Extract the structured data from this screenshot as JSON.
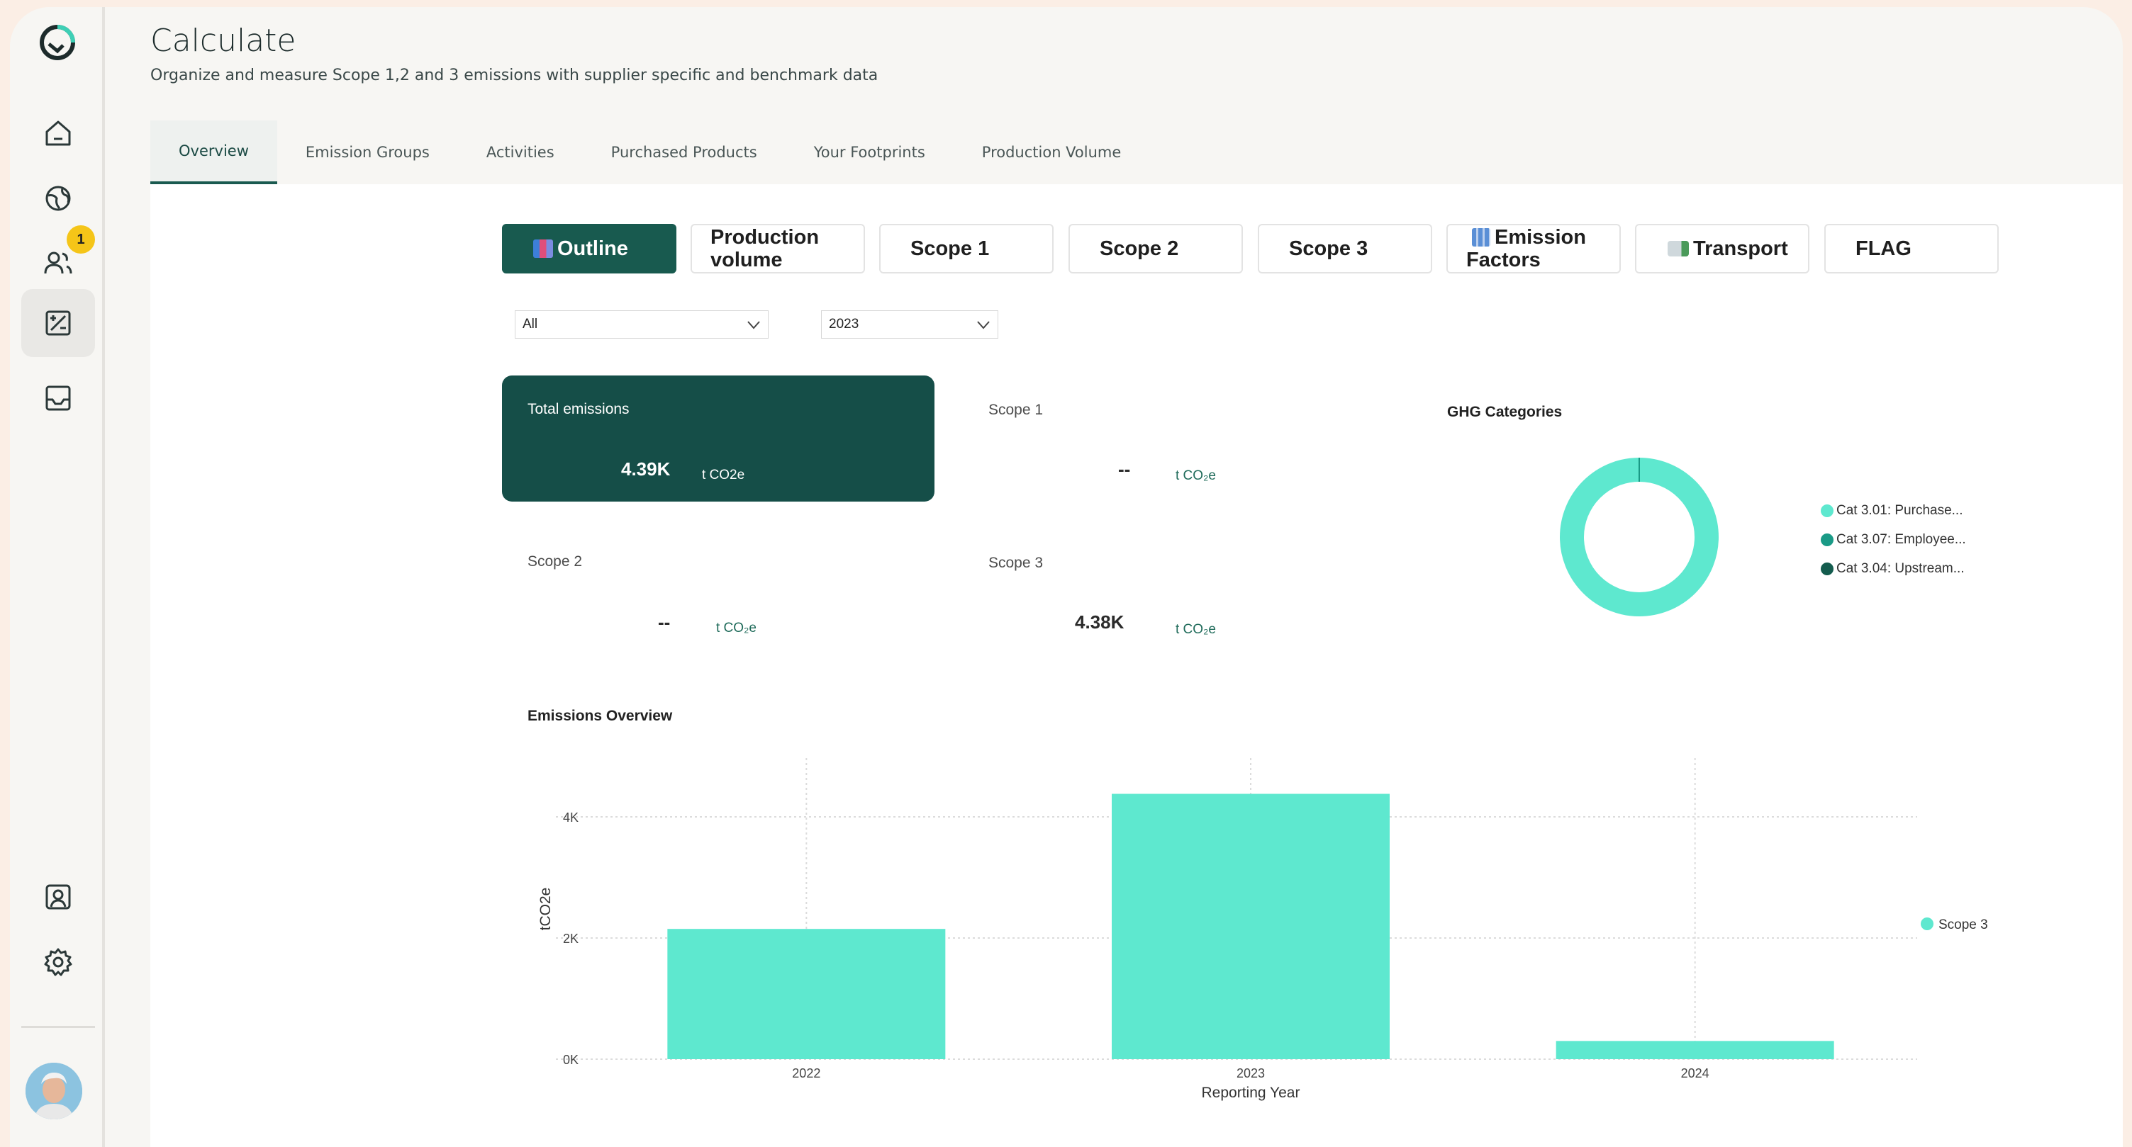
{
  "header": {
    "title": "Calculate",
    "subtitle": "Organize and measure Scope 1,2 and 3 emissions with supplier specific and benchmark data"
  },
  "tabs": [
    {
      "label": "Overview",
      "active": true
    },
    {
      "label": "Emission Groups"
    },
    {
      "label": "Activities"
    },
    {
      "label": "Purchased Products"
    },
    {
      "label": "Your Footprints"
    },
    {
      "label": "Production Volume"
    }
  ],
  "sidebar": {
    "items": [
      {
        "icon": "home-icon"
      },
      {
        "icon": "globe-icon"
      },
      {
        "icon": "users-icon",
        "badge": "1"
      },
      {
        "icon": "calculator-icon",
        "active": true
      },
      {
        "icon": "inbox-icon"
      },
      {
        "icon": "account-icon"
      },
      {
        "icon": "settings-icon"
      }
    ]
  },
  "buttons": {
    "outline": "Outline",
    "production_volume_1": "Production",
    "production_volume_2": "volume",
    "scope1": "Scope 1",
    "scope2": "Scope 2",
    "scope3": "Scope 3",
    "emission_factors_1": "Emission",
    "emission_factors_2": "Factors",
    "transport": "Transport",
    "flag": "FLAG"
  },
  "filters": {
    "category": "All",
    "year": "2023"
  },
  "kpis": {
    "total": {
      "label": "Total emissions",
      "value": "4.39K",
      "unit": "t CO2e"
    },
    "scope1": {
      "label": "Scope 1",
      "value": "--",
      "unit": "t CO₂e"
    },
    "scope2": {
      "label": "Scope 2",
      "value": "--",
      "unit": "t CO₂e"
    },
    "scope3": {
      "label": "Scope 3",
      "value": "4.38K",
      "unit": "t CO₂e"
    }
  },
  "ghg": {
    "title": "GHG Categories",
    "legend": [
      {
        "label": "Cat 3.01: Purchase...",
        "color": "#5ee8cf"
      },
      {
        "label": "Cat 3.07: Employee...",
        "color": "#1a9a86"
      },
      {
        "label": "Cat 3.04: Upstream...",
        "color": "#145c4e"
      }
    ]
  },
  "colors": {
    "accent": "#185a4f",
    "bar": "#5ee8cf",
    "badge": "#f5c518"
  },
  "chart_data": {
    "type": "bar",
    "title": "Emissions Overview",
    "xlabel": "Reporting Year",
    "ylabel": "tCO2e",
    "categories": [
      "2022",
      "2023",
      "2024"
    ],
    "series": [
      {
        "name": "Scope 3",
        "values": [
          2150,
          4380,
          300
        ]
      }
    ],
    "ylim": [
      0,
      4400
    ],
    "yticks": [
      {
        "value": 0,
        "label": "0K"
      },
      {
        "value": 2000,
        "label": "2K"
      },
      {
        "value": 4000,
        "label": "4K"
      }
    ],
    "grid": true,
    "legend_position": "right"
  }
}
